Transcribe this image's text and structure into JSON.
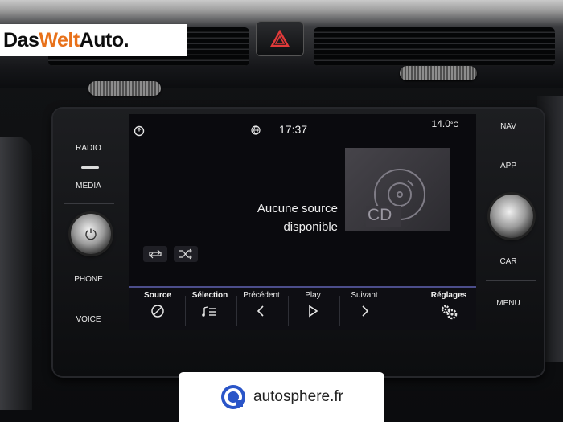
{
  "watermark": {
    "brand_das": "Das ",
    "brand_welt": "Welt",
    "brand_auto": "Auto.",
    "autosphere": "autosphere.fr"
  },
  "side_buttons": {
    "left": [
      "RADIO",
      "MEDIA",
      "PHONE",
      "VOICE"
    ],
    "right": [
      "NAV",
      "APP",
      "CAR",
      "MENU"
    ]
  },
  "status_bar": {
    "time": "17:37",
    "temperature": "14.0",
    "temperature_unit": "°C"
  },
  "media": {
    "message_line1": "Aucune source",
    "message_line2": "disponible",
    "cd_label": "CD"
  },
  "bottom_bar": {
    "source": "Source",
    "selection": "Sélection",
    "previous": "Précédent",
    "play": "Play",
    "next": "Suivant",
    "settings": "Réglages"
  },
  "icons": {
    "hazard": "hazard-triangle-icon",
    "home": "home-icon",
    "sync": "sync-icon",
    "repeat": "repeat-icon",
    "shuffle": "shuffle-icon"
  },
  "colors": {
    "accent_bar": "#4b4d8a",
    "brand_orange": "#e8711a",
    "autosphere_blue": "#2a55c8"
  }
}
